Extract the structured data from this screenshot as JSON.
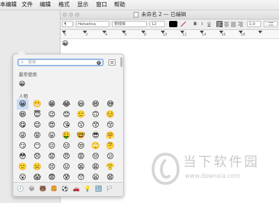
{
  "menubar": {
    "items": [
      "本编辑",
      "文件",
      "编辑",
      "格式",
      "显示",
      "窗口",
      "帮助"
    ]
  },
  "window": {
    "title": "未命名 2 — 已编辑"
  },
  "toolbar": {
    "paragraph_style": "¶",
    "font_family": "Helvetica",
    "font_style": "常规体",
    "font_size": "12",
    "bold": "B",
    "italic": "I",
    "underline": "U",
    "line_spacing": "1.0"
  },
  "ruler": {
    "numbers": [
      "0",
      "2",
      "4",
      "6",
      "8",
      "10",
      "12",
      "14",
      "16",
      "18"
    ]
  },
  "document": {
    "content": "😀"
  },
  "picker": {
    "search_placeholder": "搜索",
    "frequently_used_label": "最常使用",
    "frequently_used": [
      "😀"
    ],
    "people_label": "人物",
    "emojis": [
      "😀",
      "😬",
      "😁",
      "😂",
      "😃",
      "😄",
      "😅",
      "😆",
      "😇",
      "😉",
      "😊",
      "🙂",
      "🙃",
      "☺️",
      "😋",
      "😌",
      "😍",
      "😘",
      "😗",
      "😙",
      "😚",
      "😜",
      "😝",
      "😛",
      "🤑",
      "🤓",
      "😎",
      "🤗",
      "😏",
      "😶",
      "😐",
      "😑",
      "😒",
      "🙄",
      "🤔",
      "😳",
      "😞",
      "😟",
      "😠",
      "😡",
      "😔",
      "😕",
      "🙁",
      "☹️",
      "😣",
      "😖",
      "😫",
      "😩",
      "😤",
      "😮",
      "😱",
      "😨",
      "😰",
      "😯",
      "😦",
      "😧"
    ],
    "selected_index": 0,
    "categories": [
      "🕘",
      "😀",
      "🐻",
      "🍔",
      "⚽",
      "🚗",
      "💡",
      "🔣",
      "🏳"
    ]
  },
  "watermark": {
    "brand": "当下软件园",
    "url": "www.downxia.com"
  }
}
